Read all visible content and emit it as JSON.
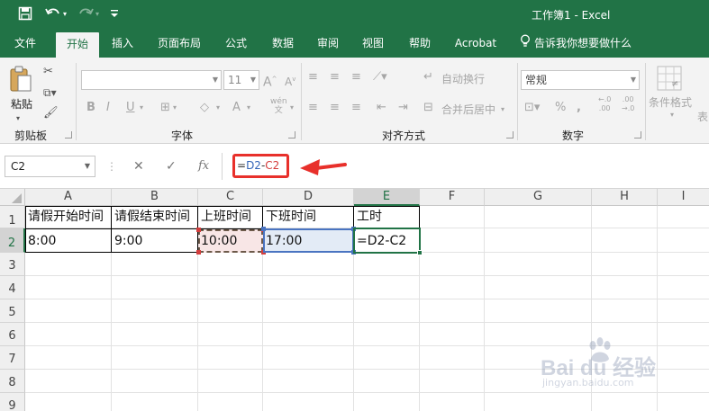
{
  "window": {
    "title": "工作簿1 - Excel"
  },
  "quick_access": {
    "save_icon": "save-icon",
    "undo_icon": "undo-icon",
    "redo_icon": "redo-icon",
    "customize_icon": "customize-icon"
  },
  "tabs": [
    "文件",
    "开始",
    "插入",
    "页面布局",
    "公式",
    "数据",
    "审阅",
    "视图",
    "帮助",
    "Acrobat"
  ],
  "active_tab": "开始",
  "tell_me": "告诉我你想要做什么",
  "ribbon": {
    "clipboard": {
      "paste_label": "粘贴",
      "group_label": "剪贴板"
    },
    "font": {
      "font_name": "",
      "font_size": "11",
      "bold": "B",
      "italic": "I",
      "underline": "U",
      "phonetic": "wén",
      "group_label": "字体"
    },
    "alignment": {
      "wrap_text": "自动换行",
      "merge_center": "合并后居中",
      "group_label": "对齐方式"
    },
    "number": {
      "format": "常规",
      "percent": "%",
      "comma": ",",
      "group_label": "数字"
    },
    "styles": {
      "conditional_format": "条件格式",
      "table_hint": "表"
    }
  },
  "formula_bar": {
    "name_box": "C2",
    "fx": "fx",
    "formula_prefix": "=",
    "formula_ref1": "D2",
    "formula_op": "-",
    "formula_ref2": "C2"
  },
  "sheet": {
    "columns": [
      "A",
      "B",
      "C",
      "D",
      "E",
      "F",
      "G",
      "H",
      "I"
    ],
    "rows": [
      "1",
      "2",
      "3",
      "4",
      "5",
      "6",
      "7",
      "8",
      "9"
    ],
    "row1": [
      "请假开始时间",
      "请假结束时间",
      "上班时间",
      "下班时间",
      "工时"
    ],
    "row2": [
      "8:00",
      "9:00",
      "10:00",
      "17:00",
      "=D2-C2"
    ],
    "selected_column": "E",
    "selected_row": "2"
  },
  "colors": {
    "excel_green": "#217346",
    "annotation_red": "#e8302b",
    "ref_blue": "#3465b8",
    "ref_red": "#d43d3d"
  },
  "watermark": {
    "brand": "Bai du 经验",
    "url": "jingyan.baidu.com"
  }
}
